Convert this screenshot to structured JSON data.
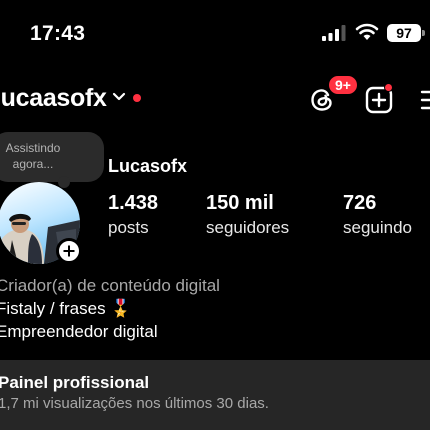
{
  "status_bar": {
    "time": "17:43",
    "battery": "97"
  },
  "header": {
    "username": "lucaasofx",
    "threads_badge": "9+"
  },
  "note": {
    "text": "Assistindo agora..."
  },
  "profile": {
    "display_name": "Lucasofx",
    "stats": [
      {
        "value": "1.438",
        "label": "posts"
      },
      {
        "value": "150 mil",
        "label": "seguidores"
      },
      {
        "value": "726",
        "label": "seguindo"
      }
    ],
    "bio": {
      "category": "Criador(a) de conteúdo digital",
      "line1": "Fistaly / frases 🎖️",
      "line2": "Empreendedor digital"
    }
  },
  "panel": {
    "title": "Painel profissional",
    "subtitle": "1,7 mi visualizações nos últimos 30 dias."
  }
}
